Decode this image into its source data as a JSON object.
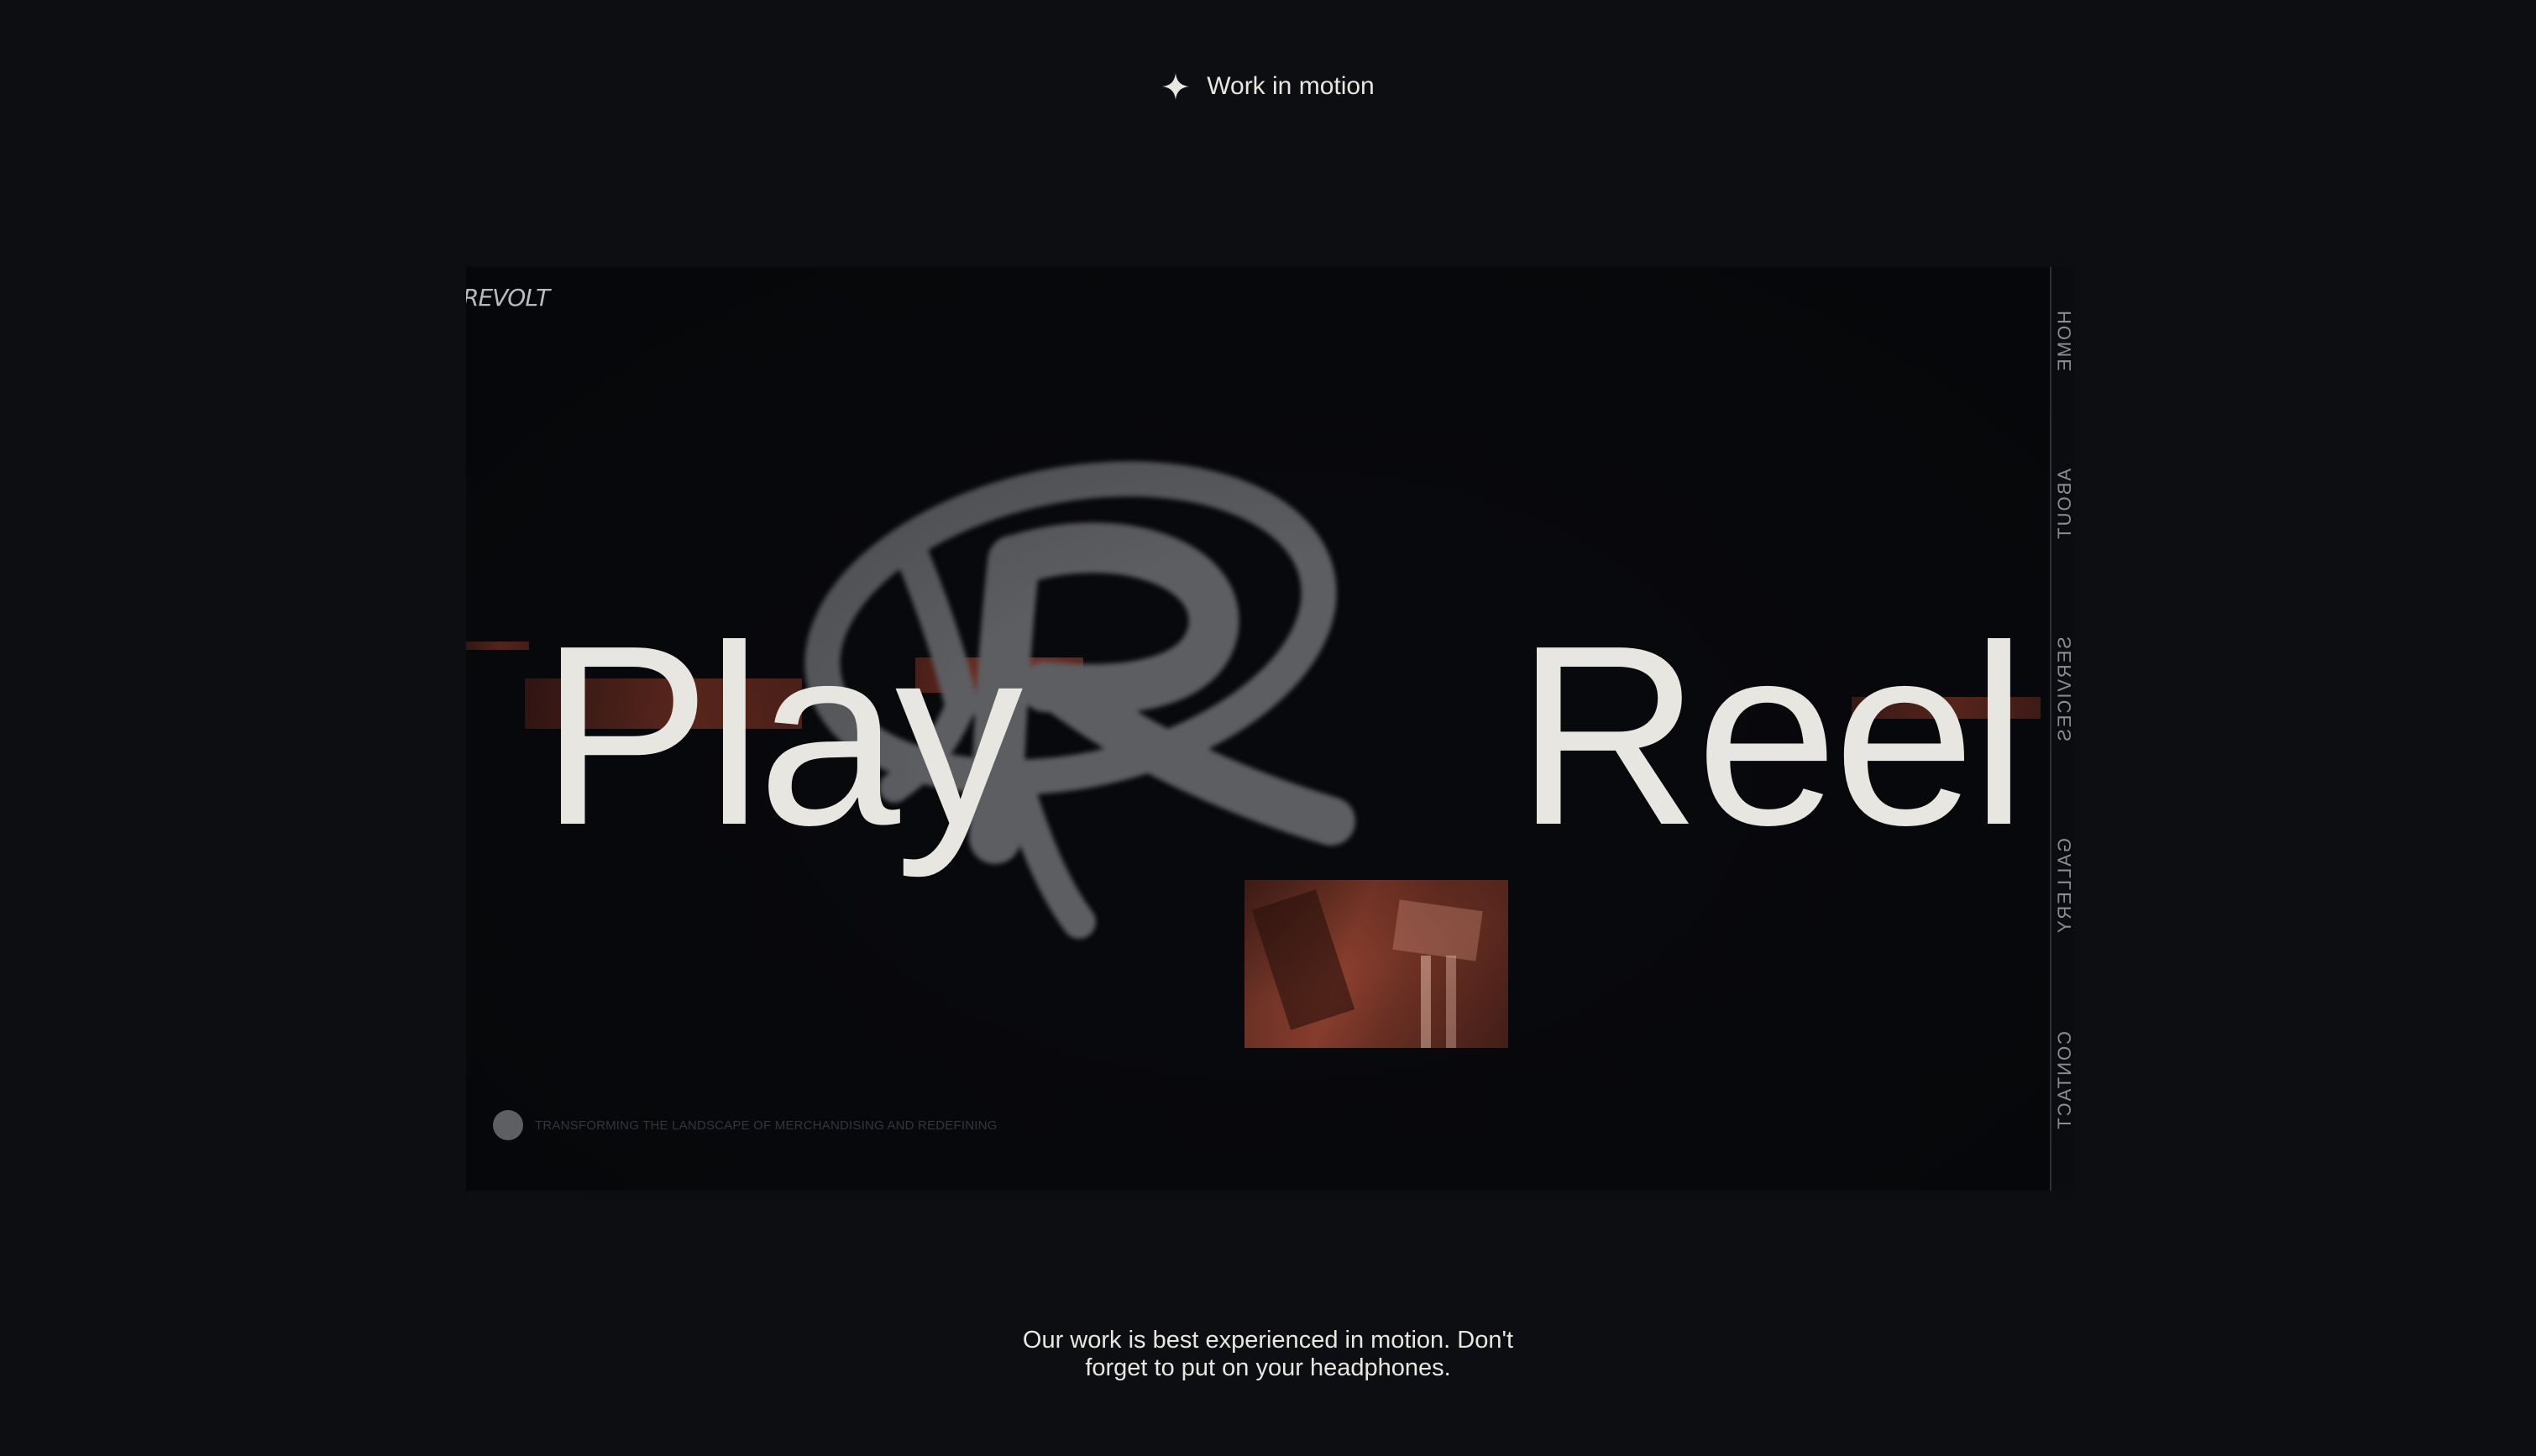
{
  "eyebrow": {
    "icon": "sparkle-icon",
    "label": "Work in motion"
  },
  "video": {
    "logo": "REVOLT",
    "title_left": "Play",
    "title_right": "Reel",
    "tagline": "TRANSFORMING THE LANDSCAPE OF MERCHANDISING AND REDEFINING",
    "side_nav": [
      "HOME",
      "ABOUT",
      "SERVICES",
      "GALLERY",
      "CONTACT"
    ]
  },
  "caption": {
    "line1": "Our work is best experienced in motion. Don't",
    "line2": "forget to put on your headphones."
  },
  "colors": {
    "background": "#0d0e12",
    "text": "#e8e6e1",
    "accent_red": "#7b3324",
    "emblem_gray": "#5d5e62"
  }
}
